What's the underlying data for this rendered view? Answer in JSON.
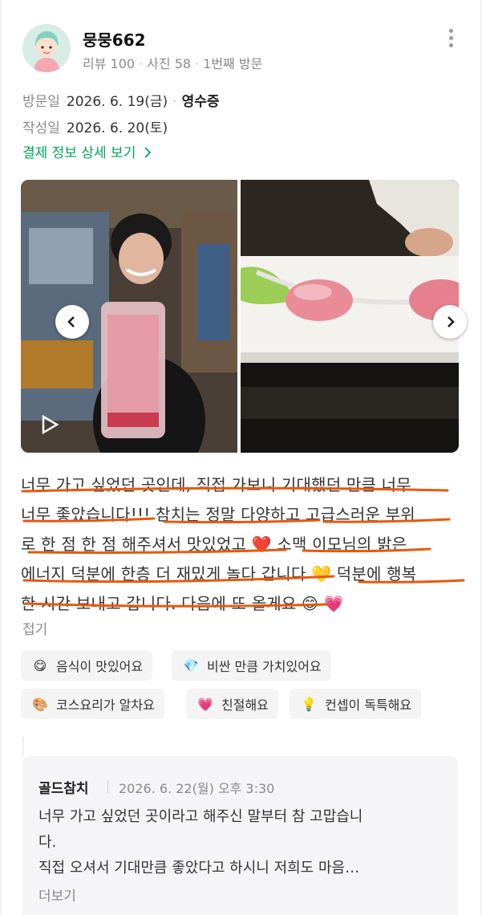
{
  "user": {
    "name": "뭉뭉662",
    "reviews": "리뷰 100",
    "photos": "사진 58",
    "visit_count": "1번째 방문",
    "avatar_icon": "user-avatar-icon"
  },
  "visit": {
    "label": "방문일",
    "date": "2026. 6. 19(금)",
    "method": "영수증"
  },
  "written": {
    "label": "작성일",
    "date": "2026. 6. 20(토)"
  },
  "payment_link": "결제 정보 상세 보기",
  "review_lines": [
    "너무 가고 싶었던 곳인데, 직접 가보니 기대했던 만큼 너무",
    "너무 좋았습니다!!! 참치는 정말 다양하고 고급스러운 부위",
    "로 한 점 한 점 해주셔서 맛있었고 ❤️ 소맥 이모님의 밝은",
    "에너지 덕분에 한층 더 재밌게 놀다 갑니다 💛 덕분에 행복",
    "한 시간 보내고 갑니다. 다음에 또 올게요 😊 💗"
  ],
  "collapse_label": "접기",
  "tags": [
    {
      "emoji": "😋",
      "label": "음식이 맛있어요"
    },
    {
      "emoji": "💎",
      "label": "비싼 만큼 가치있어요"
    },
    {
      "emoji": "🎨",
      "label": "코스요리가 알차요"
    },
    {
      "emoji": "💗",
      "label": "친절해요"
    },
    {
      "emoji": "💡",
      "label": "컨셉이 독특해요"
    }
  ],
  "reply": {
    "author": "골드참치",
    "date": "2026. 6. 22(월) 오후 3:30",
    "lines": [
      "너무 가고 싶었던 곳이라고 해주신 말부터 참 고맙습니",
      "다.",
      "직접 오셔서 기대만큼 좋았다고 하시니 저희도 마음…"
    ],
    "more_label": "더보기"
  },
  "colors": {
    "accent_green": "#03a357",
    "underline_orange": "#e8590c",
    "tag_bg": "#f4f4f5",
    "reply_bg": "#f5f5f7"
  },
  "icons": {
    "more": "more-vertical-icon",
    "prev": "chevron-left-icon",
    "next": "chevron-right-icon",
    "video": "video-play-icon"
  }
}
